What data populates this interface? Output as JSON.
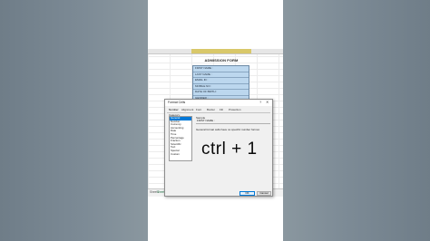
{
  "sheet": {
    "form_title": "ADMISSION FORM",
    "form_rows": [
      "FIRST NAME :",
      "LAST NAME :",
      "EMAIL ID :",
      "MOBILE NO :",
      "DATE OF BIRTH :",
      "GENDER :",
      "ADDRESS :"
    ],
    "sheet_tabs": [
      "Sheet1",
      "Sheet2"
    ]
  },
  "dialog": {
    "title": "Format Cells",
    "help_glyph": "?",
    "close_glyph": "✕",
    "tabs": [
      "Number",
      "Alignment",
      "Font",
      "Border",
      "Fill",
      "Protection"
    ],
    "category_label": "Category:",
    "categories": [
      "General",
      "Number",
      "Currency",
      "Accounting",
      "Date",
      "Time",
      "Percentage",
      "Fraction",
      "Scientific",
      "Text",
      "Special",
      "Custom"
    ],
    "selected_category": "General",
    "sample_label": "Sample",
    "sample_value": "FIRST NAME :",
    "general_description": "General format cells have no specific number format.",
    "ok_label": "OK",
    "cancel_label": "Cancel"
  },
  "overlay": {
    "shortcut_text": "ctrl + 1"
  },
  "colors": {
    "form_fill": "#bcd7ee",
    "selection_header": "#d9c86a",
    "list_selected": "#0078d7",
    "background_gray": "#8a979f"
  }
}
